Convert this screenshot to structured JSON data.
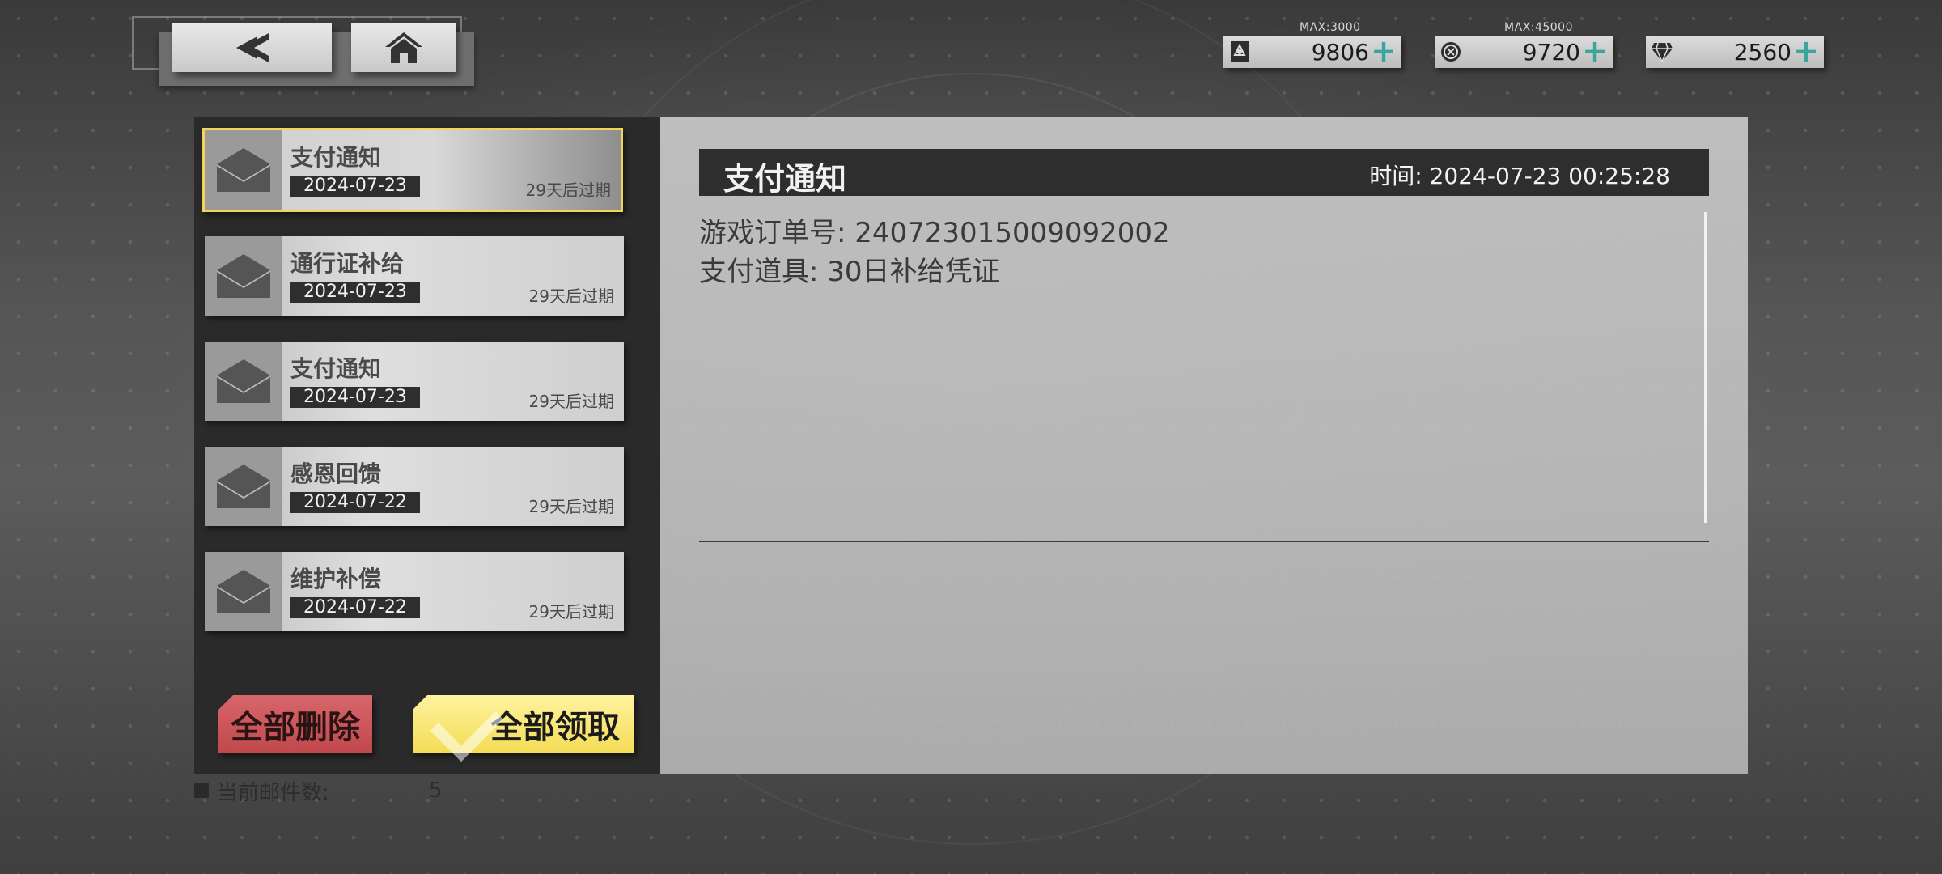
{
  "currency": [
    {
      "icon": "ticket-icon",
      "max": "MAX:3000",
      "value": "9806"
    },
    {
      "icon": "coin-icon",
      "max": "MAX:45000",
      "value": "9720"
    },
    {
      "icon": "diamond-icon",
      "max": "",
      "value": "2560"
    }
  ],
  "colors": {
    "accent_plus": "#3aa59a",
    "selected_border": "#f4d35a",
    "delete": "#c0484d",
    "claim": "#f3dc55"
  },
  "mails": [
    {
      "title": "支付通知",
      "date": "2024-07-23",
      "expiry": "29天后过期"
    },
    {
      "title": "通行证补给",
      "date": "2024-07-23",
      "expiry": "29天后过期"
    },
    {
      "title": "支付通知",
      "date": "2024-07-23",
      "expiry": "29天后过期"
    },
    {
      "title": "感恩回馈",
      "date": "2024-07-22",
      "expiry": "29天后过期"
    },
    {
      "title": "维护补偿",
      "date": "2024-07-22",
      "expiry": "29天后过期"
    }
  ],
  "buttons": {
    "delete_all": "全部删除",
    "claim_all": "全部领取"
  },
  "footer": {
    "count_label": "当前邮件数:",
    "count_value": "5"
  },
  "detail": {
    "title": "支付通知",
    "time": "时间: 2024-07-23 00:25:28",
    "lines": [
      "游戏订单号: 240723015009092002",
      "支付道具: 30日补给凭证"
    ]
  }
}
